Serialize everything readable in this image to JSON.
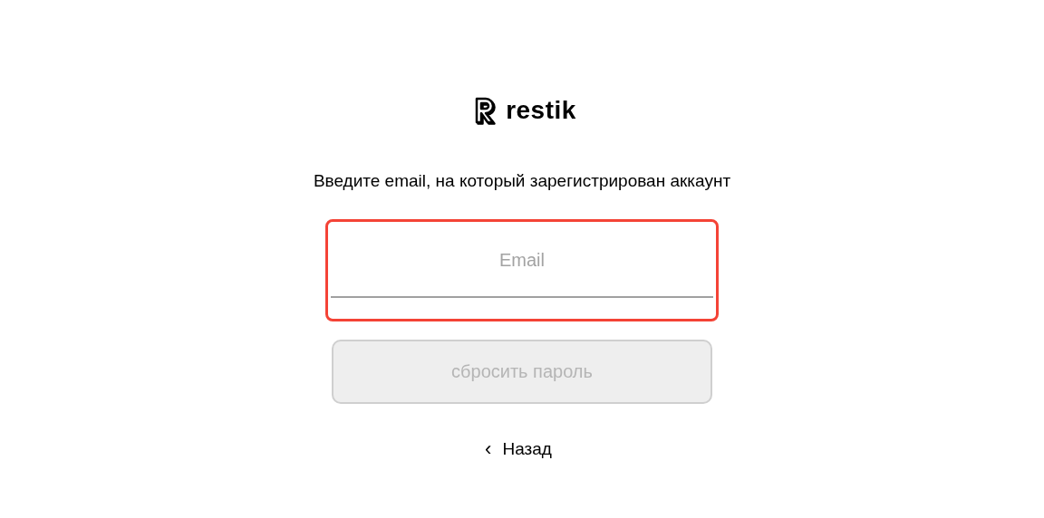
{
  "logo": {
    "text": "restik"
  },
  "prompt": "Введите email, на который зарегистрирован аккаунт",
  "email_field": {
    "placeholder": "Email",
    "error": true
  },
  "submit_button": {
    "label": "сбросить пароль",
    "disabled": true
  },
  "back_link": {
    "icon": "‹",
    "label": "Назад"
  }
}
